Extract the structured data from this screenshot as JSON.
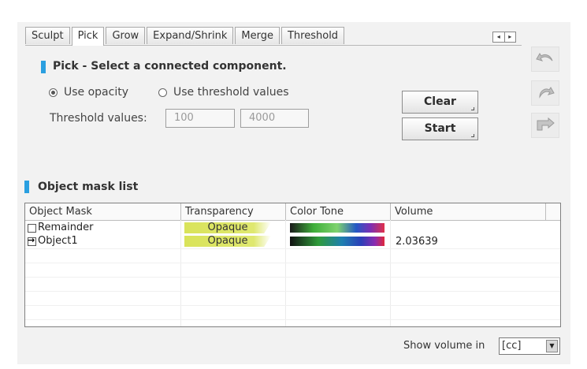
{
  "tabs": [
    "Sculpt",
    "Pick",
    "Grow",
    "Expand/Shrink",
    "Merge",
    "Threshold"
  ],
  "active_tab": "Pick",
  "pick_section": {
    "title": "Pick - Select a connected component.",
    "radio_opacity": "Use opacity",
    "radio_threshold": "Use threshold values",
    "selected_radio": "Use opacity",
    "threshold_label": "Threshold values:",
    "threshold_min": "100",
    "threshold_max": "4000",
    "clear_button": "Clear",
    "start_button": "Start"
  },
  "side_icons": [
    "undo-icon",
    "redo-icon",
    "export-mask-icon"
  ],
  "mask_list": {
    "title": "Object mask list",
    "columns": [
      "Object Mask",
      "Transparency",
      "Color Tone",
      "Volume"
    ],
    "rows": [
      {
        "name": "Remainder",
        "transparency": "Opaque",
        "volume": ""
      },
      {
        "name": "Object1",
        "transparency": "Opaque",
        "volume": "2.03639"
      }
    ]
  },
  "footer": {
    "show_volume_label": "Show volume in",
    "unit": "[cc]"
  },
  "colors": {
    "accent": "#2a9fe0",
    "opaque_fill": "#d9e35a"
  }
}
